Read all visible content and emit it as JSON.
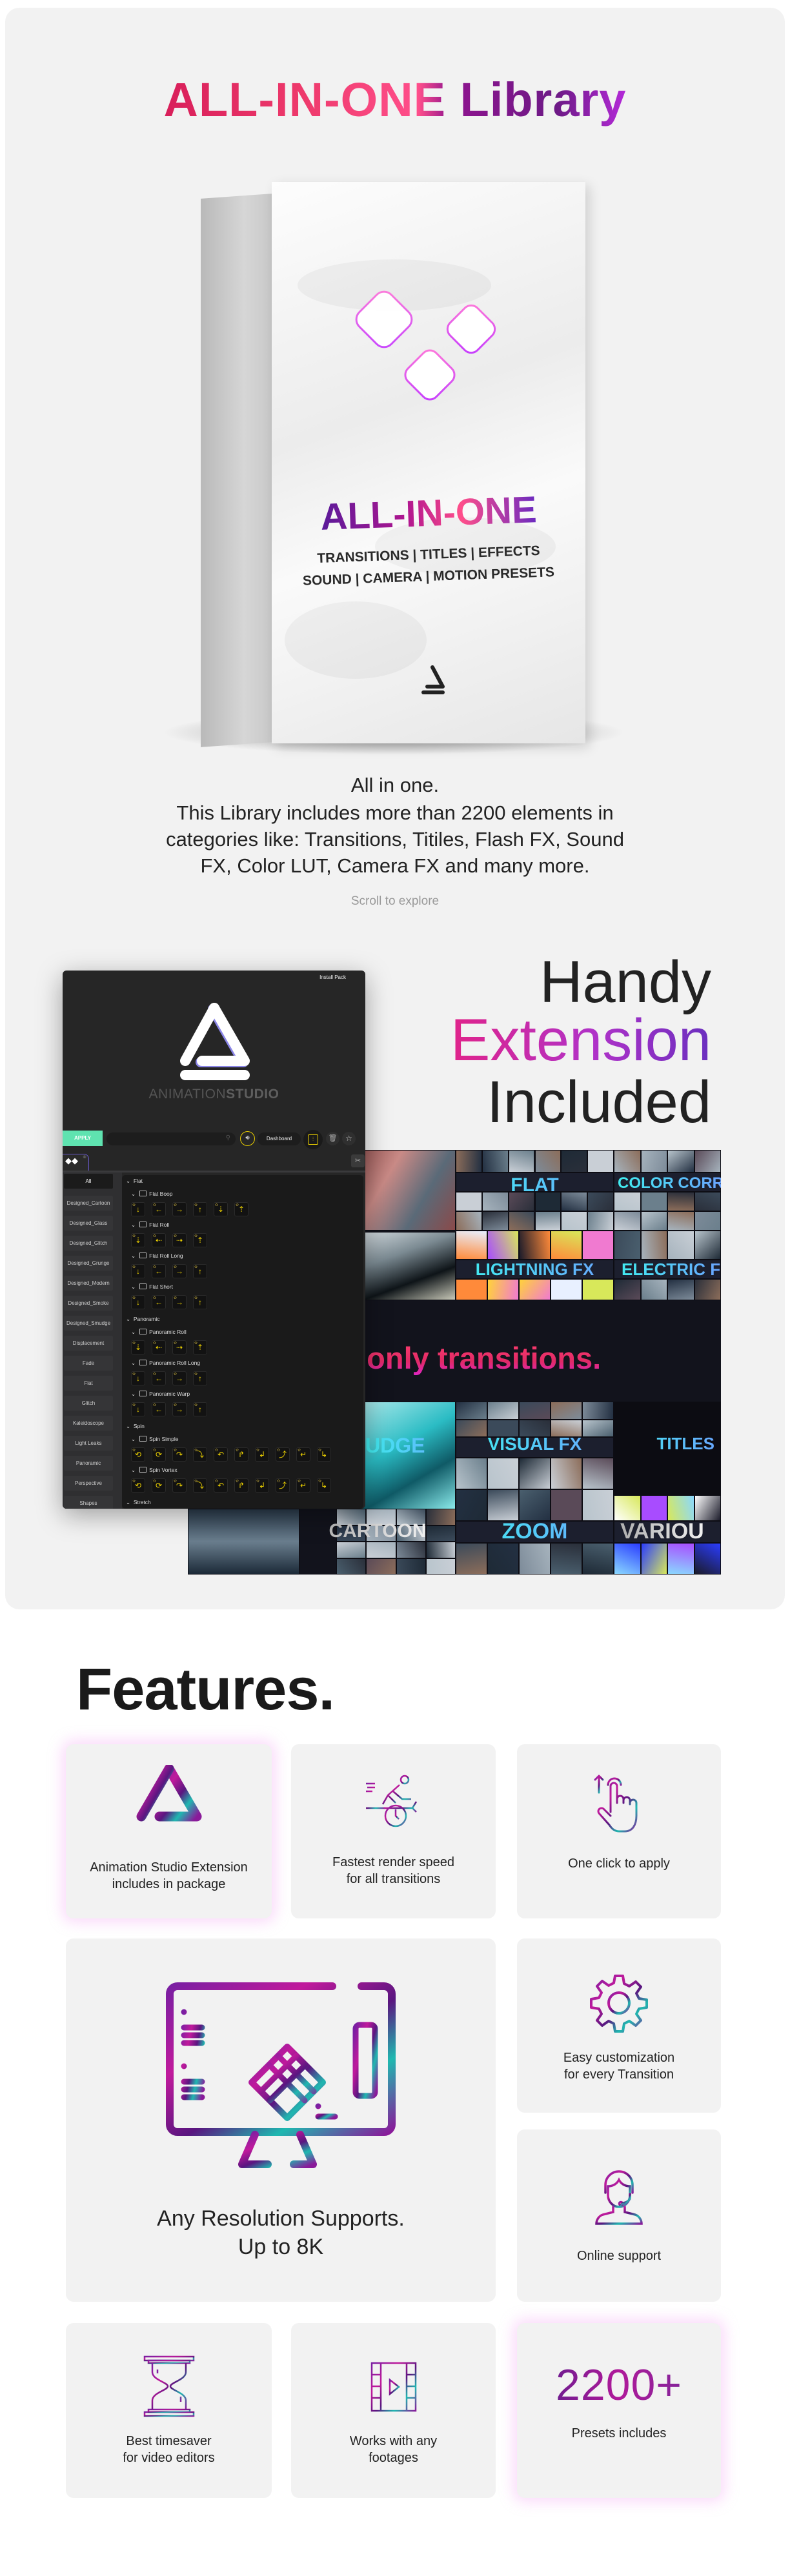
{
  "hero": {
    "title": "ALL-IN-ONE Library",
    "box": {
      "name": "ALL-IN-ONE",
      "line1": "TRANSITIONS | TITLES | EFFECTS",
      "line2": "SOUND | CAMERA | MOTION PRESETS"
    },
    "description": [
      "All in one.",
      "This Library includes more than 2200 elements in",
      "categories like: Transitions, Titiles, Flash FX, Sound",
      "FX, Color LUT, Camera FX and many more."
    ],
    "scroll_hint": "Scroll to explore"
  },
  "extension_promo": {
    "line1": "Handy",
    "line2": "Extension",
    "line3": "Included"
  },
  "extension_panel": {
    "install_pack": "Install Pack",
    "brand_light": "ANIMATION",
    "brand_bold": "STUDIO",
    "apply_label": "APPLY",
    "search_placeholder": "",
    "dashboard_label": "Dashboard",
    "accent": "#e8cc00",
    "apply_color": "#5fe3b0",
    "categories": [
      "All",
      "Designed_Cartoon",
      "Designed_Glass",
      "Designed_Glitch",
      "Designed_Grunge",
      "Designed_Modern",
      "Designed_Smoke",
      "Designed_Smudge",
      "Displacement",
      "Fade",
      "Flat",
      "Glitch",
      "Kaleidoscope",
      "Light Leaks",
      "Panoramic",
      "Perspective",
      "Shapes"
    ],
    "active_category": "All",
    "tree": [
      {
        "label": "Flat",
        "subs": [
          {
            "label": "Flat Boop",
            "icons": [
              "down",
              "left",
              "right",
              "up",
              "down-dotted",
              "up-dotted"
            ]
          },
          {
            "label": "Flat Roll",
            "icons": [
              "down-dotted",
              "left-dotted",
              "right-dotted",
              "up-dotted"
            ]
          },
          {
            "label": "Flat Roll Long",
            "icons": [
              "down",
              "left",
              "right",
              "up"
            ]
          },
          {
            "label": "Flat Short",
            "icons": [
              "down",
              "left",
              "right",
              "up"
            ]
          }
        ]
      },
      {
        "label": "Panoramic",
        "subs": [
          {
            "label": "Panoramic Roll",
            "icons": [
              "down-dotted",
              "left-dotted",
              "right-dotted",
              "up-dotted"
            ]
          },
          {
            "label": "Panoramic Roll Long",
            "icons": [
              "down",
              "left",
              "right",
              "up"
            ]
          },
          {
            "label": "Panoramic Warp",
            "icons": [
              "down",
              "left",
              "right",
              "up"
            ]
          }
        ]
      },
      {
        "label": "Spin",
        "subs": [
          {
            "label": "Spin Simple",
            "icons": [
              "spin-ccw",
              "spin-cw",
              "curve-down-right",
              "curve-right-down",
              "curve-up-left",
              "curve-up-right",
              "turn-left",
              "turn-up",
              "turn-down-left",
              "turn-down-right"
            ]
          },
          {
            "label": "Spin Vortex",
            "icons": [
              "spin-ccw",
              "spin-cw",
              "curve-down-right",
              "curve-right-down",
              "curve-up-left",
              "curve-up-right",
              "turn-left",
              "turn-up",
              "turn-down-left",
              "turn-down-right"
            ]
          }
        ]
      },
      {
        "label": "Stretch",
        "subs": []
      }
    ]
  },
  "collage": {
    "headline": "Not only transitions.",
    "labels": {
      "flat": "FLAT",
      "color": "COLOR CORREC",
      "lightning": "LIGHTNING FX",
      "electric": "ELECTRIC F",
      "smudge": "UDGE",
      "visual": "VISUAL FX",
      "titles": "TITLES",
      "cartoon": "CARTOON",
      "zoom": "ZOOM",
      "various": "VARIOU"
    }
  },
  "features": {
    "title": "Features.",
    "items": [
      {
        "icon": "animation-studio-logo-icon",
        "lines": [
          "Animation Studio Extension",
          "includes in package"
        ]
      },
      {
        "icon": "runner-speedometer-icon",
        "lines": [
          "Fastest render speed",
          "for all transitions"
        ]
      },
      {
        "icon": "hand-click-icon",
        "lines": [
          "One click to apply"
        ]
      },
      {
        "icon": "monitor-grid-icon",
        "lines": [
          "Any Resolution Supports.",
          "Up to 8K"
        ]
      },
      {
        "icon": "gear-icon",
        "lines": [
          "Easy customization",
          "for every Transition"
        ]
      },
      {
        "icon": "support-headset-icon",
        "lines": [
          "Online support"
        ]
      },
      {
        "icon": "hourglass-icon",
        "lines": [
          "Best timesaver",
          "for video editors"
        ]
      },
      {
        "icon": "film-play-icon",
        "lines": [
          "Works with any",
          "footages"
        ]
      },
      {
        "icon": "",
        "number": "2200+",
        "lines": [
          "Presets includes"
        ]
      }
    ]
  }
}
